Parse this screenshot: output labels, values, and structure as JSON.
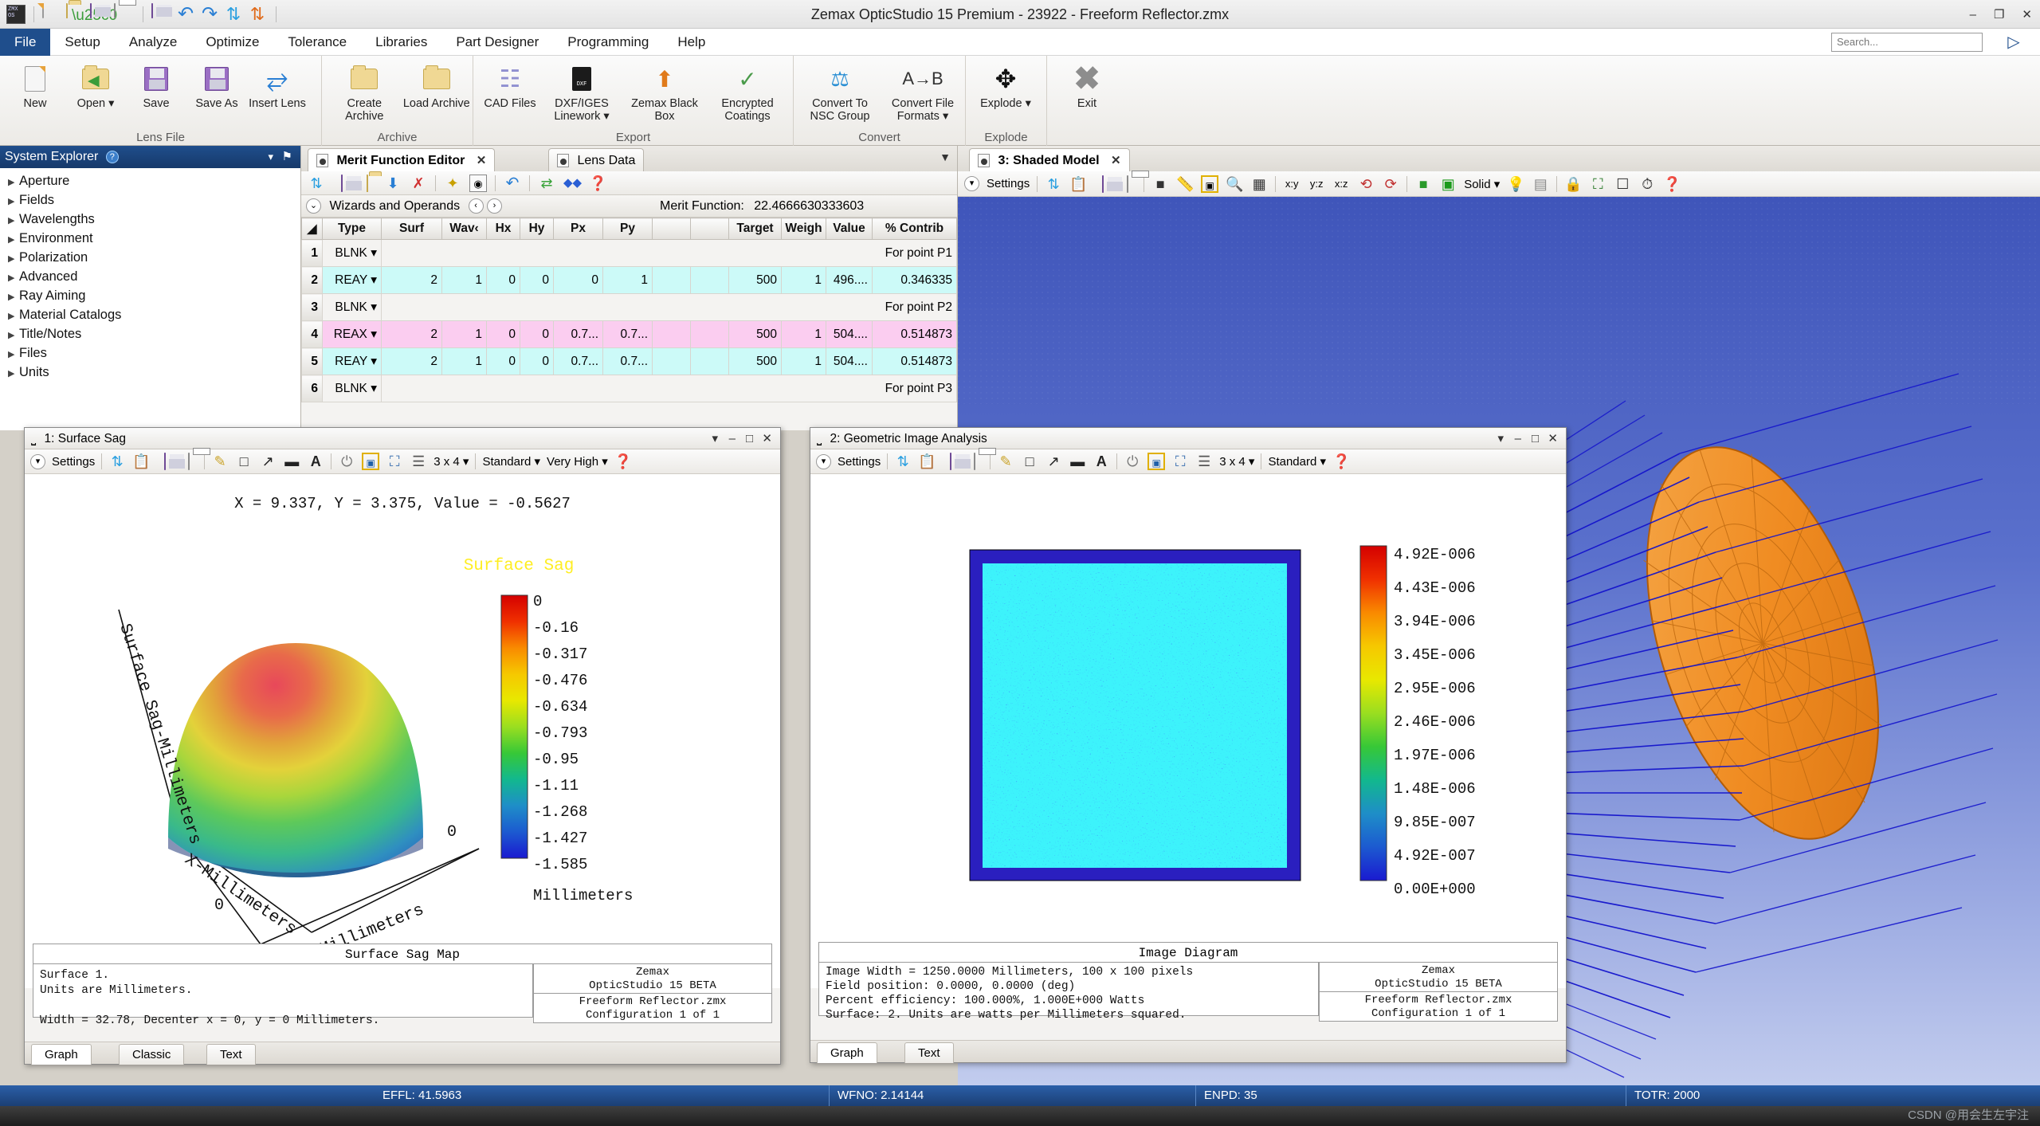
{
  "window": {
    "title": "Zemax OpticStudio 15 Premium - 23922 - Freeform Reflector.zmx",
    "minimize": "–",
    "maximize": "❐",
    "close": "✕"
  },
  "quick_access": [
    {
      "name": "new-file-icon",
      "label": "New"
    },
    {
      "name": "open-file-icon",
      "label": "Open"
    },
    {
      "name": "save-icon",
      "label": "Save"
    },
    {
      "name": "print-icon",
      "label": "Print"
    },
    {
      "name": "save-as-icon",
      "label": "Save As"
    },
    {
      "name": "undo-icon",
      "label": "Undo"
    },
    {
      "name": "redo-icon",
      "label": "Redo"
    },
    {
      "name": "update-icon",
      "label": "Update"
    },
    {
      "name": "update-all-icon",
      "label": "Update All"
    }
  ],
  "menu": {
    "items": [
      "File",
      "Setup",
      "Analyze",
      "Optimize",
      "Tolerance",
      "Libraries",
      "Part Designer",
      "Programming",
      "Help"
    ],
    "active": "File"
  },
  "search": {
    "placeholder": "Search...",
    "value": ""
  },
  "ribbon": {
    "groups": [
      {
        "label": "Lens File",
        "buttons": [
          {
            "label": "New",
            "icon": "new-document-icon"
          },
          {
            "label": "Open ▾",
            "icon": "open-folder-icon"
          },
          {
            "label": "Save",
            "icon": "floppy-save-icon"
          },
          {
            "label": "Save As",
            "icon": "floppy-save-as-icon"
          },
          {
            "label": "Insert Lens",
            "icon": "insert-lens-icon"
          }
        ]
      },
      {
        "label": "Archive",
        "buttons": [
          {
            "label": "Create Archive",
            "icon": "create-archive-icon"
          },
          {
            "label": "Load Archive",
            "icon": "load-archive-icon"
          }
        ]
      },
      {
        "label": "Export",
        "buttons": [
          {
            "label": "CAD Files",
            "icon": "cad-files-icon"
          },
          {
            "label": "DXF/IGES Linework ▾",
            "icon": "dxf-iges-icon"
          },
          {
            "label": "Zemax Black Box",
            "icon": "black-box-icon"
          },
          {
            "label": "Encrypted Coatings",
            "icon": "encrypted-coatings-icon"
          }
        ]
      },
      {
        "label": "Convert",
        "buttons": [
          {
            "label": "Convert To NSC Group",
            "icon": "convert-nsc-icon"
          },
          {
            "label": "Convert File Formats ▾",
            "icon": "convert-file-formats-icon"
          }
        ]
      },
      {
        "label": "Explode",
        "buttons": [
          {
            "label": "Explode ▾",
            "icon": "explode-icon"
          }
        ]
      },
      {
        "label": "",
        "buttons": [
          {
            "label": "Exit",
            "icon": "exit-icon"
          }
        ]
      }
    ]
  },
  "system_explorer": {
    "title": "System Explorer",
    "help_glyph": "?",
    "collapse_glyph": "▾",
    "pin_glyph": "⚑",
    "items": [
      "Aperture",
      "Fields",
      "Wavelengths",
      "Environment",
      "Polarization",
      "Advanced",
      "Ray Aiming",
      "Material Catalogs",
      "Title/Notes",
      "Files",
      "Units"
    ]
  },
  "merit_function_editor": {
    "tabs": [
      {
        "label": "Merit Function Editor",
        "selected": true,
        "close": "✕"
      },
      {
        "label": "Lens Data",
        "selected": false
      }
    ],
    "toolbar_icons": [
      "refresh-icon",
      "save-icon",
      "open-icon",
      "insert-down-icon",
      "delete-red-x-icon",
      "wizard-wand-icon",
      "properties-icon",
      "undo-arrow-icon",
      "sync-icon",
      "link-icon",
      "help-icon"
    ],
    "wizard_bar": {
      "expand_glyph": "⌄",
      "label": "Wizards and Operands",
      "prev": "‹",
      "next": "›",
      "merit_label": "Merit Function:",
      "merit_value": "22.4666630333603"
    },
    "columns": [
      "",
      "Type",
      "Surf",
      "Wav‹",
      "Hx",
      "Hy",
      "Px",
      "Py",
      "",
      "",
      "Target",
      "Weigh",
      "Value",
      "% Contrib"
    ],
    "rows": [
      {
        "num": "1",
        "type": "BLNK",
        "blank_text": "For point P1",
        "highlight": "none"
      },
      {
        "num": "2",
        "type": "REAY",
        "surf": "2",
        "wave": "1",
        "hx": "0",
        "hy": "0",
        "px": "0",
        "py": "1",
        "c8": "",
        "c9": "",
        "target": "500",
        "weight": "1",
        "value": "496....",
        "contrib": "0.346335",
        "highlight": "cyan"
      },
      {
        "num": "3",
        "type": "BLNK",
        "blank_text": "For point P2",
        "highlight": "none"
      },
      {
        "num": "4",
        "type": "REAX",
        "surf": "2",
        "wave": "1",
        "hx": "0",
        "hy": "0",
        "px": "0.7...",
        "py": "0.7...",
        "c8": "",
        "c9": "",
        "target": "500",
        "weight": "1",
        "value": "504....",
        "contrib": "0.514873",
        "highlight": "pink"
      },
      {
        "num": "5",
        "type": "REAY",
        "surf": "2",
        "wave": "1",
        "hx": "0",
        "hy": "0",
        "px": "0.7...",
        "py": "0.7...",
        "c8": "",
        "c9": "",
        "target": "500",
        "weight": "1",
        "value": "504....",
        "contrib": "0.514873",
        "highlight": "cyan"
      },
      {
        "num": "6",
        "type": "BLNK",
        "blank_text": "For point P3",
        "highlight": "none"
      }
    ]
  },
  "shaded_model": {
    "tab_label": "3: Shaded Model",
    "tab_close": "✕",
    "settings_label": "Settings",
    "toolbar_icons": [
      "refresh-icon",
      "copy-icon",
      "save-image-icon",
      "print-icon",
      "annotate-icon",
      "ruler-icon",
      "zoom-icon",
      "zoom-window-icon",
      "xy-axis-icon",
      "yz-axis-icon",
      "xz-axis-icon",
      "rotate-left-icon",
      "rotate-right-icon",
      "color-icon",
      "solid-model-icon",
      "light-icon",
      "grid-icon",
      "lock-icon",
      "window-icon",
      "clock-icon",
      "help-icon"
    ],
    "render_mode": "Solid",
    "axis_labels": [
      "x:y",
      "y:z",
      "x:z"
    ]
  },
  "surface_sag_window": {
    "title": "1: Surface Sag",
    "restore_glyph": "❐",
    "minimize_glyph": "–",
    "maximize_glyph": "□",
    "close_glyph": "✕",
    "dropdown_glyph": "▾",
    "settings_label": "Settings",
    "toolbar_icons": [
      "refresh-icon",
      "copy-icon",
      "save-image-icon",
      "print-icon",
      "pencil-icon",
      "rectangle-icon",
      "arrow-icon",
      "line-icon",
      "text-icon",
      "lamp-icon",
      "fit-window-icon",
      "detach-icon",
      "layers-icon"
    ],
    "grid_size": "3 x 4",
    "style": "Standard",
    "quality": "Very High",
    "readout": "X = 9.337, Y = 3.375, Value = -0.5627",
    "plot_title": "Surface Sag",
    "axis_x": "X-Millimeters",
    "axis_y": "Y-Millimeters",
    "axis_z": "Surface Sag-Millimeters",
    "axis_tick_x": "0",
    "axis_tick_y": "0",
    "colorbar_units": "Millimeters",
    "colorbar_labels": [
      "0",
      "-0.16",
      "-0.317",
      "-0.476",
      "-0.634",
      "-0.793",
      "-0.95",
      "-1.11",
      "-1.268",
      "-1.427",
      "-1.585"
    ],
    "footer_title": "Surface Sag Map",
    "footer_left": "Surface 1.\nUnits are Millimeters.\n\nWidth = 32.78, Decenter x = 0, y = 0 Millimeters.",
    "footer_mid": "Zemax\nOpticStudio 15  BETA",
    "footer_mid2": "Freeform Reflector.zmx\nConfiguration 1 of 1",
    "bottom_tabs": [
      {
        "label": "Graph",
        "selected": true
      },
      {
        "label": "Classic",
        "selected": false
      },
      {
        "label": "Text",
        "selected": false
      }
    ]
  },
  "image_analysis_window": {
    "title": "2: Geometric Image Analysis",
    "minimize_glyph": "▾",
    "min2_glyph": "–",
    "max_glyph": "□",
    "close_glyph": "✕",
    "settings_label": "Settings",
    "toolbar_icons": [
      "refresh-icon",
      "copy-icon",
      "save-image-icon",
      "print-icon",
      "pencil-icon",
      "rectangle-icon",
      "arrow-icon",
      "line-icon",
      "text-icon",
      "lamp-icon",
      "fit-window-icon",
      "detach-icon",
      "layers-icon"
    ],
    "grid_size": "3 x 4",
    "style": "Standard",
    "colorbar_labels": [
      "4.92E-006",
      "4.43E-006",
      "3.94E-006",
      "3.45E-006",
      "2.95E-006",
      "2.46E-006",
      "1.97E-006",
      "1.48E-006",
      "9.85E-007",
      "4.92E-007",
      "0.00E+000"
    ],
    "footer_title": "Image Diagram",
    "footer_left": "Image Width = 1250.0000 Millimeters, 100 x 100 pixels\nField position:      0.0000, 0.0000 (deg)\nPercent efficiency: 100.000%, 1.000E+000 Watts\nSurface: 2. Units are watts per Millimeters squared.",
    "footer_mid": "Zemax\nOpticStudio 15  BETA",
    "footer_mid2": "Freeform Reflector.zmx\nConfiguration 1 of 1",
    "bottom_tabs": [
      {
        "label": "Graph",
        "selected": true
      },
      {
        "label": "Text",
        "selected": false
      }
    ]
  },
  "status_bar": {
    "cells": [
      "EFFL: 41.5963",
      "WFNO: 2.14144",
      "ENPD: 35",
      "TOTR: 2000"
    ]
  },
  "watermark": "CSDN @用会生左宇注",
  "colors": {
    "accent": "#1f4e8c",
    "row_cyan": "#ccfaf8",
    "row_pink": "#fbcdf0",
    "surface_sag_title": "#ffff33",
    "image_bg": "#2a1fbf",
    "model_bg": "#5f74cf",
    "reflector": "#f0902a",
    "rays": "#1a1ad0"
  }
}
